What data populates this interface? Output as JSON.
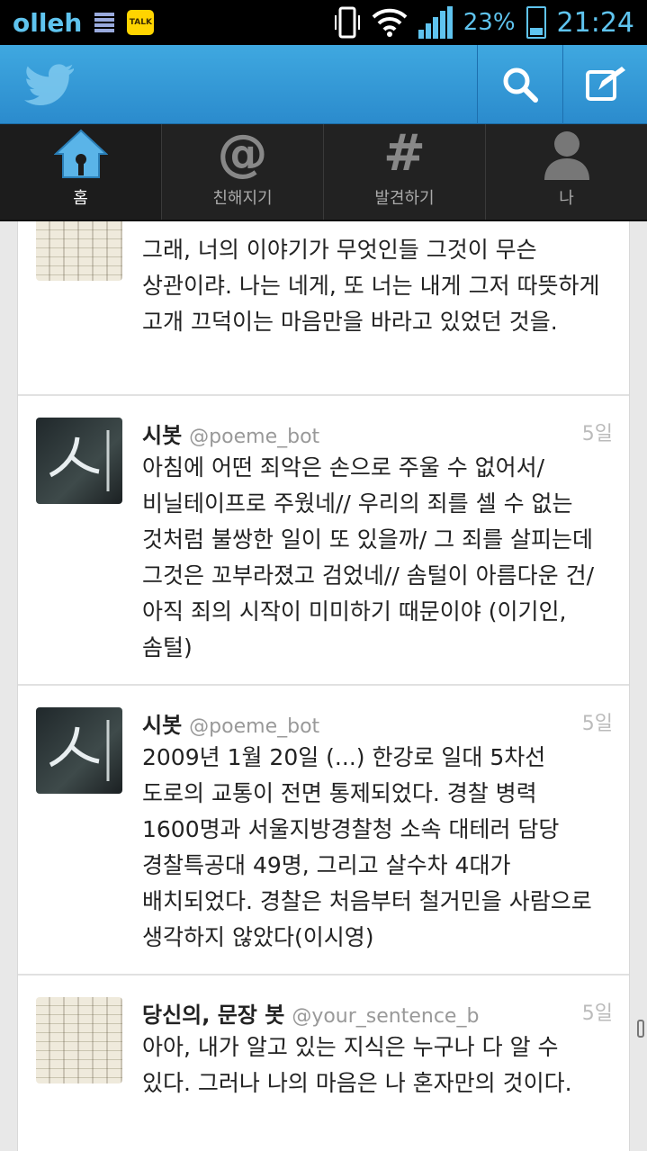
{
  "statusbar": {
    "carrier": "olleh",
    "talk_badge": "TALK",
    "battery": "23%",
    "time": "21:24"
  },
  "header": {
    "logo_icon": "twitter-bird-icon",
    "actions": [
      "search-icon",
      "compose-icon"
    ]
  },
  "tabs": [
    {
      "label": "홈",
      "icon": "home-icon",
      "active": true
    },
    {
      "label": "친해지기",
      "icon": "at-icon",
      "active": false
    },
    {
      "label": "발견하기",
      "icon": "hash-icon",
      "active": false
    },
    {
      "label": "나",
      "icon": "person-icon",
      "active": false
    }
  ],
  "timeline": {
    "tweets": [
      {
        "name": "",
        "handle": "",
        "time": "",
        "text": "그래, 너의 이야기가 무엇인들 그것이 무슨 상관이랴. 나는 네게, 또 너는 내게 그저 따뜻하게 고개 끄덕이는 마음만을 바라고 있었던 것을."
      },
      {
        "name": "시봇",
        "handle": "@poeme_bot",
        "time": "5일",
        "text": "아침에 어떤 죄악은 손으로 주울 수 없어서/ 비닐테이프로 주웠네// 우리의 죄를 셀 수 없는 것처럼 불쌍한 일이 또 있을까/ 그 죄를 살피는데 그것은 꼬부라졌고 검었네// 솜털이 아름다운 건/ 아직 죄의 시작이 미미하기 때문이야 (이기인, 솜털)"
      },
      {
        "name": "시봇",
        "handle": "@poeme_bot",
        "time": "5일",
        "text": "2009년 1월 20일 (...) 한강로 일대 5차선 도로의 교통이 전면 통제되었다. 경찰 병력 1600명과 서울지방경찰청 소속 대테러 담당 경찰특공대 49명, 그리고 살수차 4대가 배치되었다. 경찰은 처음부터 철거민을 사람으로 생각하지 않았다(이시영)"
      },
      {
        "name": "당신의, 문장 봇",
        "handle": "@your_sentence_b",
        "time": "5일",
        "text": "아아, 내가 알고 있는 지식은 누구나 다 알 수 있다. 그러나 나의 마음은 나 혼자만의 것이다."
      }
    ]
  }
}
